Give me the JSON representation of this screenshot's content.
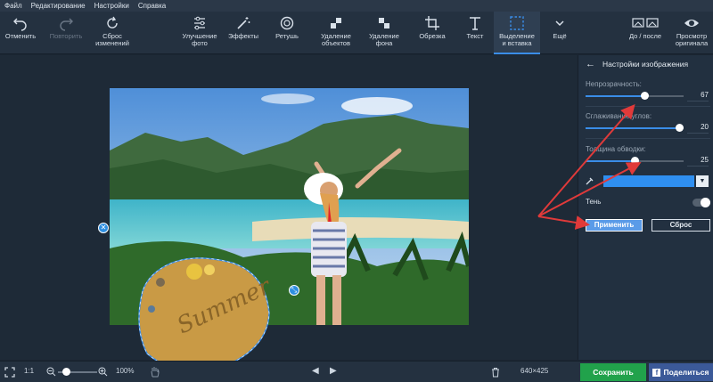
{
  "menu": [
    "Файл",
    "Редактирование",
    "Настройки",
    "Справка"
  ],
  "toolbar": {
    "undo": "Отменить",
    "redo": "Повторить",
    "reset_changes": "Сброс\nизменений",
    "enhance": "Улучшение\nфото",
    "effects": "Эффекты",
    "retouch": "Ретушь",
    "remove_objects": "Удаление\nобъектов",
    "remove_bg": "Удаление\nфона",
    "crop": "Обрезка",
    "text": "Текст",
    "select_insert": "Выделение\nи вставка",
    "more": "Ещё",
    "before_after": "До / после",
    "view_original": "Просмотр\nоригинала"
  },
  "panel": {
    "title": "Настройки изображения",
    "opacity": {
      "label": "Непрозрачность:",
      "value": "67",
      "fraction": 0.6
    },
    "smoothing": {
      "label": "Сглаживание углов:",
      "value": "20",
      "fraction": 0.95
    },
    "stroke": {
      "label": "Толщина обводки:",
      "value": "25",
      "fraction": 0.5
    },
    "stroke_color": "#2f8ff0",
    "shadow_label": "Тень",
    "shadow_on": false,
    "apply": "Применить",
    "reset": "Сброс"
  },
  "canvas": {
    "sticker_text": "Summer"
  },
  "status": {
    "ratio": "1:1",
    "zoom": "100%",
    "dimensions": "640×425",
    "save": "Сохранить",
    "share": "Поделиться"
  },
  "colors": {
    "accent": "#3a8de8",
    "save": "#21a24b",
    "facebook": "#3b5998",
    "arrow": "#e03a3a"
  }
}
